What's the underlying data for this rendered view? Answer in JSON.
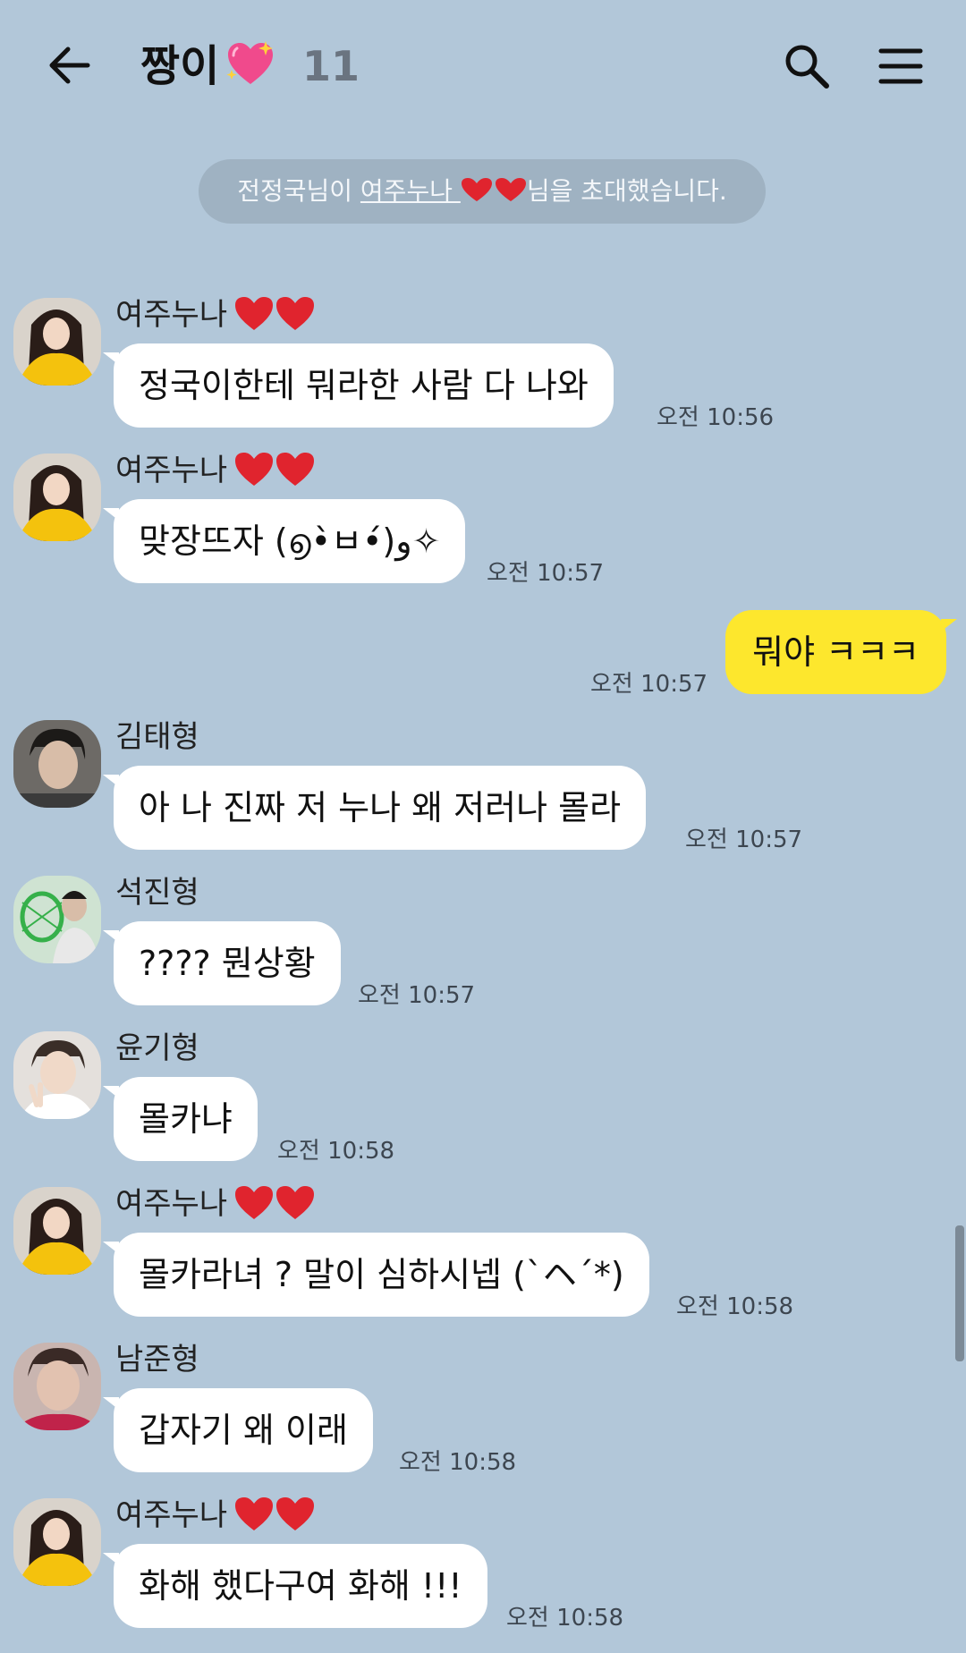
{
  "header": {
    "title": "짱이",
    "member_count": "11",
    "icons": [
      "back-arrow-icon",
      "sparkling-heart-icon",
      "search-icon",
      "menu-icon"
    ]
  },
  "notice": {
    "before": "전정국님이 ",
    "link": "여주누나 ",
    "after": "님을 초대했습니다."
  },
  "messages": [
    {
      "sender": "여주누나",
      "text": "정국이한테 뭐라한 사람 다 나와",
      "time": "오전 10:56"
    },
    {
      "sender": "여주누나",
      "text": "맞장뜨자 (൭•̀ㅂ•́)و✧",
      "time": "오전 10:57"
    },
    {
      "sender": "",
      "text": "뭐야 ㅋㅋㅋ",
      "time": "오전 10:57",
      "mine": true
    },
    {
      "sender": "김태형",
      "text": "아 나 진짜 저 누나 왜 저러나 몰라",
      "time": "오전 10:57"
    },
    {
      "sender": "석진형",
      "text": "???? 뭔상황",
      "time": "오전 10:57"
    },
    {
      "sender": "윤기형",
      "text": "몰카냐",
      "time": "오전 10:58"
    },
    {
      "sender": "여주누나",
      "text": "몰카라녀 ? 말이 심하시넵 (`ヘ´*)",
      "time": "오전 10:58"
    },
    {
      "sender": "남준형",
      "text": "갑자기 왜 이래",
      "time": "오전 10:58"
    },
    {
      "sender": "여주누나",
      "text": "화해 했다구여 화해 !!!",
      "time": "오전 10:58"
    }
  ],
  "colors": {
    "background": "#b2c7d9",
    "my_bubble": "#fde72d",
    "other_bubble": "#ffffff",
    "notice_bg": "#9fb2c2"
  }
}
